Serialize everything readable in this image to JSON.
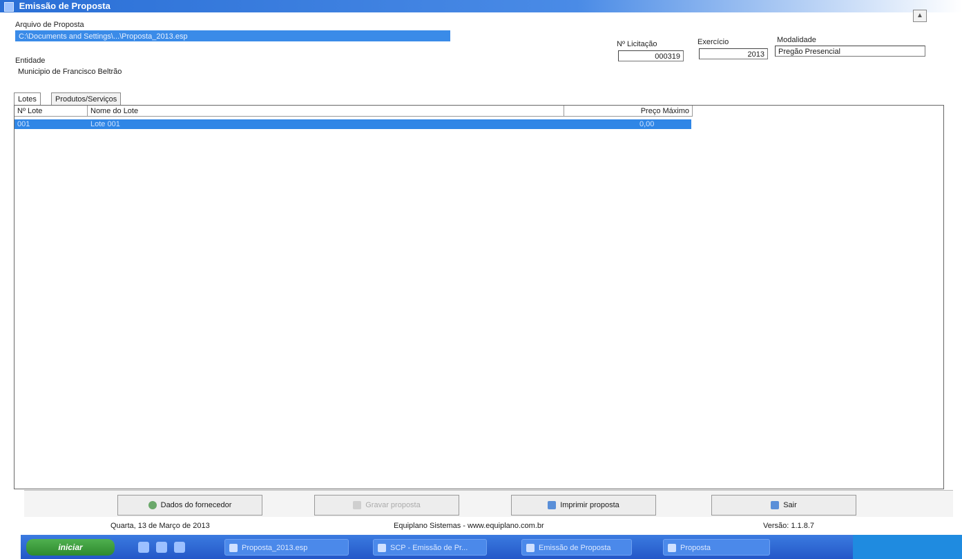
{
  "window": {
    "title": "Emissão de Proposta"
  },
  "proposal": {
    "file_label": "Arquivo de Proposta",
    "file_value": "C:\\Documents and Settings\\...\\Proposta_2013.esp",
    "entity_label": "Entidade",
    "entity_value": "Municipio de Francisco Beltrão",
    "licitacao_label": "Nº Licitação",
    "licitacao_value": "000319",
    "exercicio_label": "Exercício",
    "exercicio_value": "2013",
    "modalidade_label": "Modalidade",
    "modalidade_value": "Pregão Presencial"
  },
  "tabs": [
    {
      "label": "Lotes"
    },
    {
      "label": "Produtos/Serviços"
    }
  ],
  "grid": {
    "headers": {
      "lot_no": "Nº Lote",
      "lot_name": "Nome do Lote",
      "max_price": "Preço Máximo"
    },
    "rows": [
      {
        "lot_no": "001",
        "lot_name": "Lote 001",
        "max_price": "0,00"
      }
    ]
  },
  "buttons": {
    "supplier": "Dados do fornecedor",
    "save": "Gravar proposta",
    "print": "Imprimir proposta",
    "exit": "Sair"
  },
  "status": {
    "date": "Quarta, 13 de Março de 2013",
    "company": "Equiplano Sistemas - www.equiplano.com.br",
    "version": "Versão: 1.1.8.7"
  },
  "taskbar": {
    "start": "iniciar",
    "items": [
      "Proposta_2013.esp",
      "SCP - Emissão de Pr...",
      "Emissão de Proposta",
      "Proposta"
    ]
  }
}
